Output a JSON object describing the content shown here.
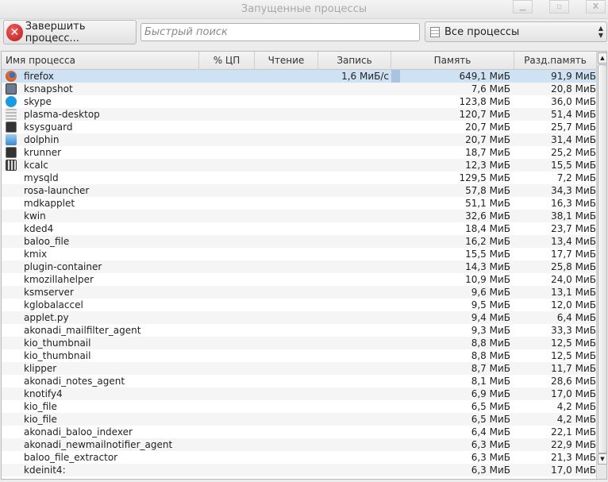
{
  "window": {
    "title": "Запущенные процессы",
    "minimize": "▁",
    "maximize": "▫",
    "close": "X"
  },
  "toolbar": {
    "kill_label": "Завершить процесс...",
    "search_placeholder": "Быстрый поиск",
    "filter_value": "Все процессы"
  },
  "columns": [
    "Имя процесса",
    "% ЦП",
    "Чтение",
    "Запись",
    "Память",
    "Разд.память"
  ],
  "colors": {
    "selection": "#cfe2f3",
    "kill_icon": "#c82020"
  },
  "rows": [
    {
      "name": "firefox",
      "icon": "firefox-icon",
      "write": "1,6 МиБ/с",
      "mem": "649,1 МиБ",
      "shared": "91,9 МиБ",
      "selected": true
    },
    {
      "name": "ksnapshot",
      "icon": "camera-icon",
      "mem": "7,6 МиБ",
      "shared": "20,8 МиБ"
    },
    {
      "name": "skype",
      "icon": "skype-icon",
      "mem": "123,8 МиБ",
      "shared": "36,0 МиБ"
    },
    {
      "name": "plasma-desktop",
      "icon": "plasma-icon",
      "mem": "120,7 МиБ",
      "shared": "51,4 МиБ"
    },
    {
      "name": "ksysguard",
      "icon": "monitor-icon",
      "mem": "20,7 МиБ",
      "shared": "25,7 МиБ"
    },
    {
      "name": "dolphin",
      "icon": "folder-icon",
      "mem": "20,7 МиБ",
      "shared": "31,4 МиБ"
    },
    {
      "name": "krunner",
      "icon": "monitor-icon",
      "mem": "18,7 МиБ",
      "shared": "25,2 МиБ"
    },
    {
      "name": "kcalc",
      "icon": "calculator-icon",
      "mem": "12,3 МиБ",
      "shared": "15,5 МиБ"
    },
    {
      "name": "mysqld",
      "mem": "129,5 МиБ",
      "shared": "7,2 МиБ"
    },
    {
      "name": "rosa-launcher",
      "mem": "57,8 МиБ",
      "shared": "34,3 МиБ"
    },
    {
      "name": "mdkapplet",
      "mem": "51,1 МиБ",
      "shared": "16,3 МиБ"
    },
    {
      "name": "kwin",
      "mem": "32,6 МиБ",
      "shared": "38,1 МиБ"
    },
    {
      "name": "kded4",
      "mem": "18,4 МиБ",
      "shared": "23,7 МиБ"
    },
    {
      "name": "baloo_file",
      "mem": "16,2 МиБ",
      "shared": "13,4 МиБ"
    },
    {
      "name": "kmix",
      "mem": "15,5 МиБ",
      "shared": "17,7 МиБ"
    },
    {
      "name": "plugin-container",
      "mem": "14,3 МиБ",
      "shared": "25,8 МиБ"
    },
    {
      "name": "kmozillahelper",
      "mem": "10,9 МиБ",
      "shared": "24,0 МиБ"
    },
    {
      "name": "ksmserver",
      "mem": "9,6 МиБ",
      "shared": "13,1 МиБ"
    },
    {
      "name": "kglobalaccel",
      "mem": "9,5 МиБ",
      "shared": "12,0 МиБ"
    },
    {
      "name": "applet.py",
      "mem": "9,4 МиБ",
      "shared": "6,4 МиБ"
    },
    {
      "name": "akonadi_mailfilter_agent",
      "mem": "9,3 МиБ",
      "shared": "33,3 МиБ"
    },
    {
      "name": "kio_thumbnail",
      "mem": "8,8 МиБ",
      "shared": "12,5 МиБ"
    },
    {
      "name": "kio_thumbnail",
      "mem": "8,8 МиБ",
      "shared": "12,5 МиБ"
    },
    {
      "name": "klipper",
      "mem": "8,7 МиБ",
      "shared": "11,7 МиБ"
    },
    {
      "name": "akonadi_notes_agent",
      "mem": "8,1 МиБ",
      "shared": "28,6 МиБ"
    },
    {
      "name": "knotify4",
      "mem": "6,9 МиБ",
      "shared": "17,0 МиБ"
    },
    {
      "name": "kio_file",
      "mem": "6,5 МиБ",
      "shared": "4,2 МиБ"
    },
    {
      "name": "kio_file",
      "mem": "6,5 МиБ",
      "shared": "4,2 МиБ"
    },
    {
      "name": "akonadi_baloo_indexer",
      "mem": "6,4 МиБ",
      "shared": "22,1 МиБ"
    },
    {
      "name": "akonadi_newmailnotifier_agent",
      "mem": "6,3 МиБ",
      "shared": "22,9 МиБ"
    },
    {
      "name": "baloo_file_extractor",
      "mem": "6,3 МиБ",
      "shared": "21,3 МиБ"
    },
    {
      "name": "kdeinit4:",
      "mem": "6,3 МиБ",
      "shared": "17,0 МиБ"
    }
  ]
}
